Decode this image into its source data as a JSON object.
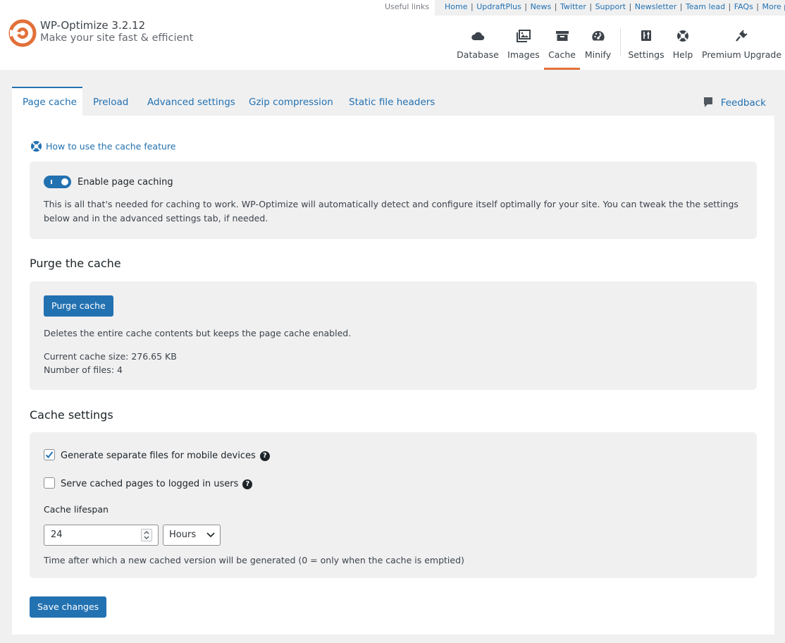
{
  "app": {
    "title": "WP-Optimize 3.2.12",
    "tagline": "Make your site fast & efficient",
    "accent_color": "#e2703a",
    "link_color": "#2271b1"
  },
  "useful_links": {
    "label": "Useful links",
    "links": [
      "Home",
      "UpdraftPlus",
      "News",
      "Twitter",
      "Support",
      "Newsletter",
      "Team lead",
      "FAQs",
      "More plugins"
    ]
  },
  "nav": {
    "items": [
      {
        "label": "Database",
        "icon": "cloud-icon"
      },
      {
        "label": "Images",
        "icon": "images-icon"
      },
      {
        "label": "Cache",
        "icon": "archive-icon",
        "active": true
      },
      {
        "label": "Minify",
        "icon": "dashboard-icon"
      },
      {
        "label": "Settings",
        "icon": "admin-generic-icon"
      },
      {
        "label": "Help",
        "icon": "lifebuoy-icon"
      },
      {
        "label": "Premium Upgrade",
        "icon": "plug-icon"
      }
    ]
  },
  "tabs": {
    "items": [
      "Page cache",
      "Preload",
      "Advanced settings",
      "Gzip compression",
      "Static file headers"
    ],
    "active": "Page cache",
    "feedback": "Feedback"
  },
  "page_cache": {
    "howto_link": "How to use the cache feature",
    "enable": {
      "label": "Enable page caching",
      "checked": true,
      "description": "This is all that's needed for caching to work. WP-Optimize will automatically detect and configure itself optimally for your site. You can tweak the the settings below and in the advanced settings tab, if needed."
    },
    "purge": {
      "heading": "Purge the cache",
      "button": "Purge cache",
      "description": "Deletes the entire cache contents but keeps the page cache enabled.",
      "cache_size": "Current cache size: 276.65 KB",
      "file_count": "Number of files: 4"
    },
    "settings": {
      "heading": "Cache settings",
      "mobile_label": "Generate separate files for mobile devices",
      "mobile_checked": true,
      "logged_in_label": "Serve cached pages to logged in users",
      "logged_in_checked": false,
      "lifespan_label": "Cache lifespan",
      "lifespan_value": "24",
      "lifespan_unit": "Hours",
      "lifespan_description": "Time after which a new cached version will be generated (0 = only when the cache is emptied)"
    },
    "save_button": "Save changes"
  }
}
